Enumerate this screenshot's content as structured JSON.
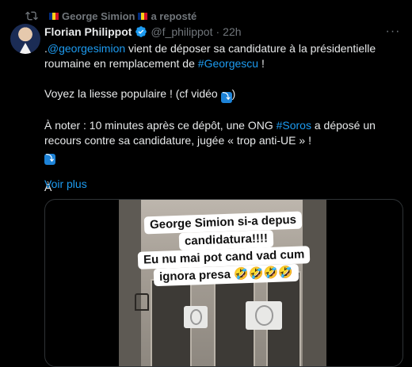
{
  "repost": {
    "name": "George Simion",
    "suffix": "a reposté",
    "flag": "romania-flag"
  },
  "author": {
    "name": "Florian Philippot",
    "handle": "@f_philippot",
    "separator": "·",
    "time": "22h"
  },
  "tweet": {
    "line1_prefix": ".",
    "mention": "@georgesimion",
    "line1_rest": " vient de déposer sa candidature à la présidentielle roumaine en remplacement de ",
    "hashtag_georgescu": "#Georgescu",
    "line1_end": " !",
    "line2": "Voyez la liesse populaire ! (cf vidéo ",
    "line2_end": ")",
    "line3_prefix": "À noter : 10 minutes après ce dépôt, une ONG ",
    "hashtag_soros": "#Soros",
    "line3_rest": " a déposé un recours contre sa candidature, jugée « trop anti-UE » !",
    "line4": "À",
    "emoji_arrow": "⤵"
  },
  "voir_plus": "Voir plus",
  "video_caption": {
    "line1": "George Simion si-a depus",
    "line2": "candidatura!!!!",
    "line3": "Eu nu mai pot cand vad cum",
    "line4": "ignora presa 🤣🤣🤣🤣"
  },
  "colors": {
    "link": "#1d9bf0",
    "background": "#000000",
    "muted": "#71767b"
  }
}
